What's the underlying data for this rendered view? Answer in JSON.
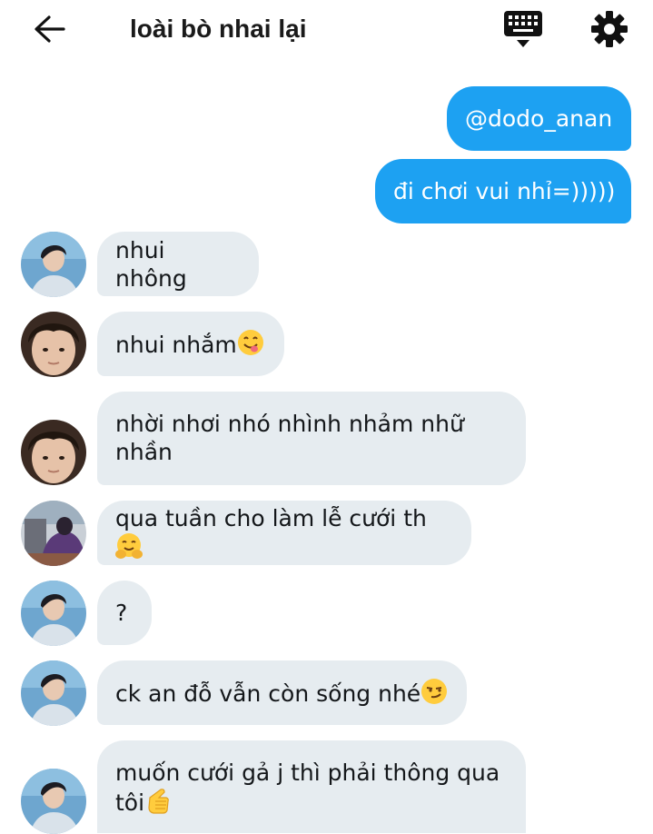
{
  "header": {
    "title": "loài bò nhai lại",
    "back_icon": "arrow-left-icon",
    "keyboard_icon": "keyboard-icon",
    "settings_icon": "gear-icon"
  },
  "colors": {
    "outgoing_bubble": "#1da1f2",
    "incoming_bubble": "#e6ecf0"
  },
  "messages": [
    {
      "direction": "out",
      "text": "@dodo_anan"
    },
    {
      "direction": "out",
      "text": "đi chơi vui nhỉ=)))))"
    },
    {
      "direction": "in",
      "avatar": "avatar-a",
      "text": "nhui nhông"
    },
    {
      "direction": "in",
      "avatar": "avatar-b",
      "text": "nhui nhắm",
      "emoji": "face-savoring-food-emoji"
    },
    {
      "direction": "in",
      "avatar": "avatar-b",
      "text": "nhời nhơi nhó nhình nhảm nhữ",
      "text2": "nhần"
    },
    {
      "direction": "in",
      "avatar": "avatar-c",
      "text": "qua tuần cho làm lễ cưới th",
      "emoji": "hugging-face-emoji"
    },
    {
      "direction": "in",
      "avatar": "avatar-a",
      "text": "?"
    },
    {
      "direction": "in",
      "avatar": "avatar-a",
      "text": "ck an đỗ vẫn còn sống nhé",
      "emoji": "smirking-face-emoji"
    },
    {
      "direction": "in",
      "avatar": "avatar-a",
      "text": "muốn cưới gả j thì phải thông qua",
      "text2": "tôi",
      "emoji": "pointing-hand-emoji"
    }
  ]
}
